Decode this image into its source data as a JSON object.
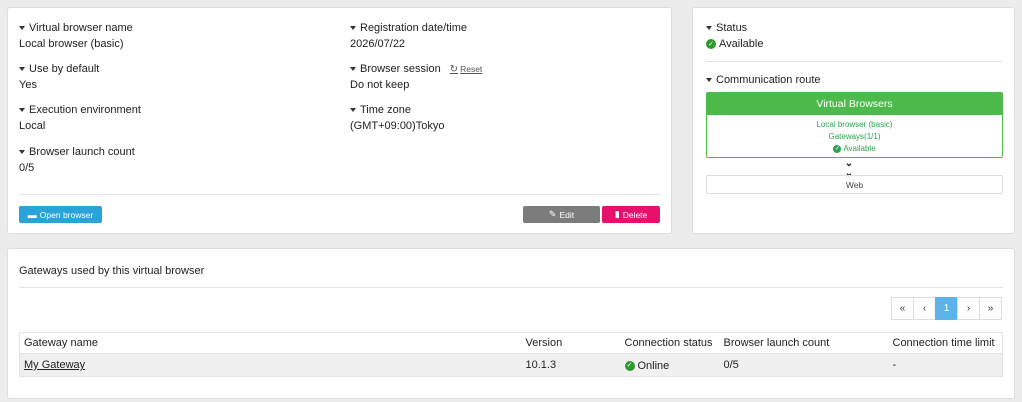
{
  "details": {
    "virtual_browser_name": {
      "label": "Virtual browser name",
      "value": "Local browser (basic)"
    },
    "use_by_default": {
      "label": "Use by default",
      "value": "Yes"
    },
    "execution_environment": {
      "label": "Execution environment",
      "value": "Local"
    },
    "browser_launch_count": {
      "label": "Browser launch count",
      "value": "0/5"
    },
    "registration_datetime": {
      "label": "Registration date/time",
      "value": "2026/07/22"
    },
    "browser_session": {
      "label": "Browser session",
      "value": "Do not keep",
      "reset_label": "Reset"
    },
    "time_zone": {
      "label": "Time zone",
      "value": "(GMT+09:00)Tokyo"
    },
    "buttons": {
      "open_browser": "Open browser",
      "edit": "Edit",
      "delete": "Delete"
    }
  },
  "status": {
    "label": "Status",
    "value": "Available",
    "communication_route_label": "Communication route",
    "route": {
      "header": "Virtual Browsers",
      "line1": "Local browser (basic)",
      "line2": "Gateways(1/1)",
      "line3": "Available",
      "web": "Web"
    }
  },
  "gateways": {
    "title": "Gateways used by this virtual browser",
    "pagination": {
      "first": "«",
      "prev": "‹",
      "current": "1",
      "next": "›",
      "last": "»"
    },
    "columns": [
      "Gateway name",
      "Version",
      "Connection status",
      "Browser launch count",
      "Connection time limit"
    ],
    "rows": [
      {
        "name": "My Gateway",
        "version": "10.1.3",
        "status": "Online",
        "launch_count": "0/5",
        "time_limit": "-"
      }
    ]
  },
  "colors": {
    "accent_blue": "#2aa3d9",
    "delete_pink": "#e6116c",
    "edit_gray": "#7c7c7c",
    "route_green": "#4cbb4c",
    "status_green": "#2b9a2b",
    "page_active": "#5bb3e9"
  },
  "icons": {
    "caret": "caret-down-icon",
    "reset": "refresh-icon",
    "open": "window-icon",
    "edit": "edit-icon",
    "delete": "trash-icon",
    "available": "check-circle-icon",
    "route_arrow": "double-chevron-down-icon"
  }
}
